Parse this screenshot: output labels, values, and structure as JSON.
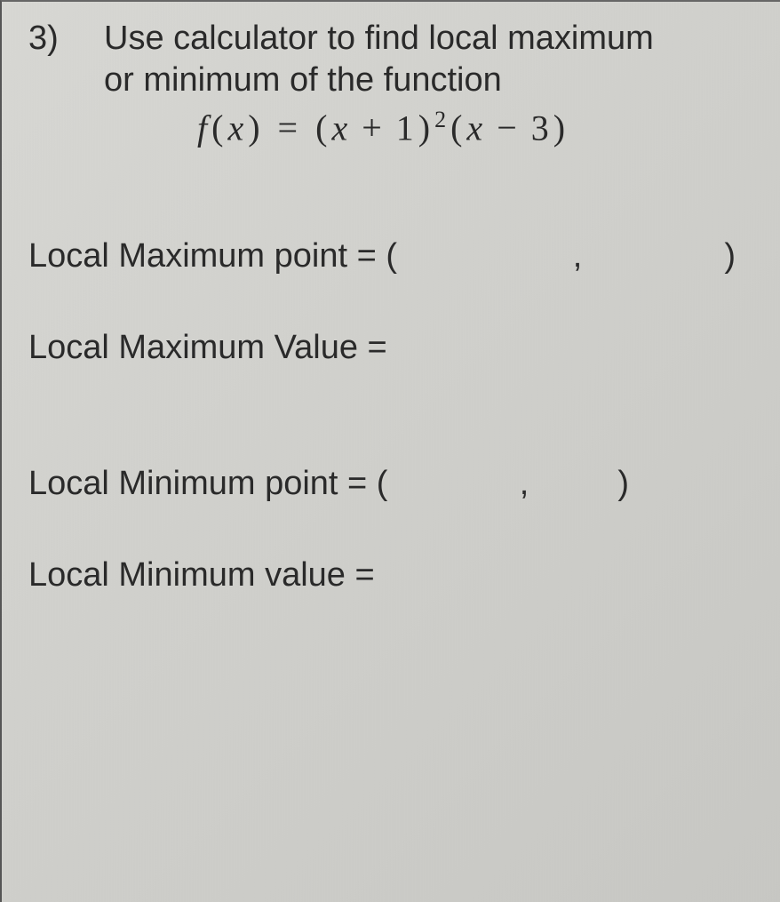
{
  "question": {
    "number": "3)",
    "prompt_line1": "Use calculator to find local maximum",
    "prompt_line2": "or minimum of the function",
    "function": "f(x) = (x + 1)²(x − 3)"
  },
  "answers": {
    "local_max_point_label": "Local Maximum point = (",
    "local_max_point_comma": ",",
    "local_max_point_close": ")",
    "local_max_value_label": "Local Maximum Value =",
    "local_min_point_label": "Local Minimum point = (",
    "local_min_point_comma": ",",
    "local_min_point_close": ")",
    "local_min_value_label": "Local Minimum value ="
  }
}
